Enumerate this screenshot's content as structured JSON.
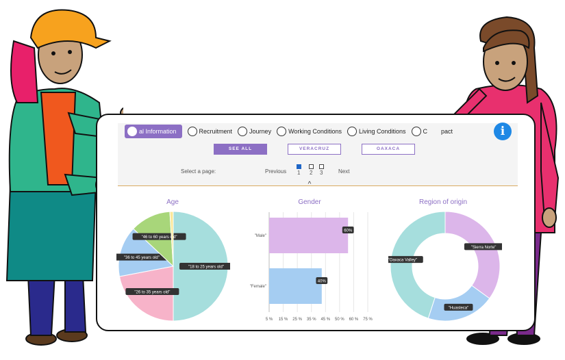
{
  "nav": {
    "tabs": [
      {
        "label": "al Information",
        "icon": "person-icon",
        "active": true
      },
      {
        "label": "Recruitment",
        "icon": "recruiter-icon",
        "active": false
      },
      {
        "label": "Journey",
        "icon": "bus-icon",
        "active": false
      },
      {
        "label": "Working Conditions",
        "icon": "worker-icon",
        "active": false
      },
      {
        "label": "Living Conditions",
        "icon": "house-icon",
        "active": false
      },
      {
        "label": "C",
        "icon": "clock-icon",
        "active": false
      },
      {
        "label": "pact",
        "icon": "impact-icon",
        "active": false
      }
    ],
    "info_label": "i"
  },
  "filters": [
    "SEE ALL",
    "VERACRUZ",
    "OAXACA"
  ],
  "pager": {
    "label": "Select a page:",
    "previous": "Previous",
    "next": "Next",
    "pages": [
      "1",
      "2",
      "3"
    ],
    "selected": "1"
  },
  "colors": {
    "accent": "#8c6fc4",
    "info": "#1e88e5"
  },
  "chart_data": [
    {
      "type": "pie",
      "title": "Age",
      "labels": [
        "\"18 to 25 years old\"",
        "\"26 to 35 years old\"",
        "\"36 to 45 years old\"",
        "\"46 to 60 years old\"",
        ""
      ],
      "values": [
        50,
        22,
        15,
        12,
        1
      ],
      "colors": [
        "#a6dedd",
        "#f7b3c9",
        "#a5cdf2",
        "#a8d67a",
        "#fbe89a"
      ]
    },
    {
      "type": "bar",
      "orientation": "horizontal",
      "title": "Gender",
      "categories": [
        "\"Male\"",
        "\"Female\""
      ],
      "values": [
        60,
        40
      ],
      "value_labels": [
        "60%",
        "40%"
      ],
      "colors": [
        "#dcb6ea",
        "#a5cdf2"
      ],
      "xticks": [
        "5 %",
        "15 %",
        "25 %",
        "35 %",
        "45 %",
        "50 %",
        "60 %",
        "75 %"
      ],
      "xlim": [
        0,
        75
      ]
    },
    {
      "type": "pie",
      "donut": true,
      "title": "Region of origin",
      "labels": [
        "\"Sierra Norte\"",
        "\"Huasteca\"",
        "\"Oaxaca Valley\""
      ],
      "values": [
        35,
        20,
        45
      ],
      "colors": [
        "#dcb6ea",
        "#a5cdf2",
        "#a6dedd"
      ]
    }
  ]
}
